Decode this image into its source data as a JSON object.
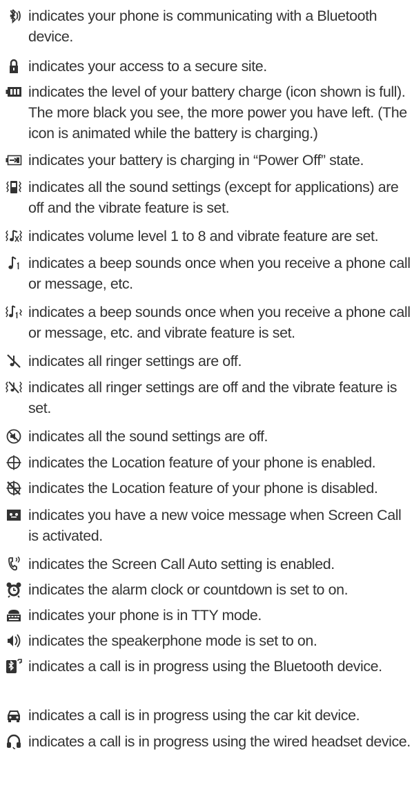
{
  "items": [
    {
      "icon": "bluetooth-communicating-icon",
      "text": "indicates your phone is communicating with a Bluetooth device."
    },
    {
      "icon": "secure-lock-icon",
      "text": "indicates your access to a secure site."
    },
    {
      "icon": "battery-full-icon",
      "text": "indicates the level of your battery charge (icon shown is full). The more black you see, the more power you have left. (The icon is animated while the battery is charging.)"
    },
    {
      "icon": "battery-charging-power-off-icon",
      "text": "indicates your battery is charging in “Power Off” state."
    },
    {
      "icon": "vibrate-all-sounds-off-icon",
      "text": "indicates all the sound settings (except for applications) are off and the vibrate feature is set."
    },
    {
      "icon": "volume-vibrate-icon",
      "text": "indicates volume level 1 to 8 and vibrate feature are set."
    },
    {
      "icon": "beep-once-icon",
      "text": "indicates a beep sounds once when you receive a phone call or message, etc."
    },
    {
      "icon": "beep-once-vibrate-icon",
      "text": "indicates a beep sounds once when you receive a phone call or message, etc. and vibrate feature is set."
    },
    {
      "icon": "ringer-off-icon",
      "text": "indicates all ringer settings are off."
    },
    {
      "icon": "ringer-off-vibrate-icon",
      "text": "indicates all ringer settings are off and the vibrate feature is set."
    },
    {
      "icon": "all-sounds-off-icon",
      "text": "indicates all the sound settings are off."
    },
    {
      "icon": "location-on-icon",
      "text": "indicates the Location feature of your phone is enabled."
    },
    {
      "icon": "location-off-icon",
      "text": "indicates the Location feature of your phone is disabled."
    },
    {
      "icon": "voice-message-screen-call-icon",
      "text": "indicates you have a new voice message when Screen Call is activated."
    },
    {
      "icon": "screen-call-auto-icon",
      "text": "indicates the Screen Call Auto setting is enabled."
    },
    {
      "icon": "alarm-clock-icon",
      "text": "indicates the alarm clock or countdown is set to on."
    },
    {
      "icon": "tty-mode-icon",
      "text": "indicates your phone is in TTY mode."
    },
    {
      "icon": "speakerphone-icon",
      "text": "indicates the speakerphone mode is set to on."
    },
    {
      "icon": "bluetooth-call-icon",
      "text": "indicates a call is in progress using the Bluetooth device."
    },
    {
      "icon": "car-kit-icon",
      "text": "indicates a call is in progress using the car kit device."
    },
    {
      "icon": "wired-headset-icon",
      "text": "indicates a call is in progress using the wired headset device."
    }
  ]
}
